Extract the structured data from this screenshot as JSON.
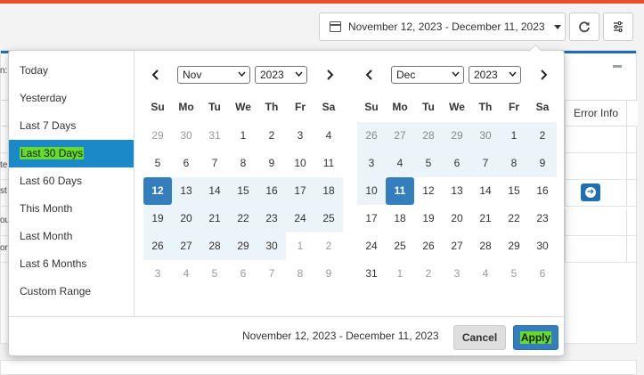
{
  "toolbar": {
    "date_range": "November 12, 2023 - December 11, 2023",
    "calendar_icon": "calendar-icon",
    "refresh_icon": "refresh-icon",
    "filter_icon": "sliders-icon"
  },
  "background": {
    "column_header": "Error Info",
    "left_fragments": [
      "n:",
      "te",
      "st",
      "ou",
      "or"
    ]
  },
  "ranges": [
    "Today",
    "Yesterday",
    "Last 7 Days",
    "Last 30 Days",
    "Last 60 Days",
    "This Month",
    "Last Month",
    "Last 6 Months",
    "Custom Range"
  ],
  "active_range": "Last 30 Days",
  "day_headers": [
    "Su",
    "Mo",
    "Tu",
    "We",
    "Th",
    "Fr",
    "Sa"
  ],
  "left_calendar": {
    "month": "Nov",
    "year": "2023",
    "prev_icon": "chevron-left-icon",
    "next_icon": "chevron-right-icon",
    "days": [
      [
        "29",
        "30",
        "31",
        "1",
        "2",
        "3",
        "4"
      ],
      [
        "5",
        "6",
        "7",
        "8",
        "9",
        "10",
        "11"
      ],
      [
        "12",
        "13",
        "14",
        "15",
        "16",
        "17",
        "18"
      ],
      [
        "19",
        "20",
        "21",
        "22",
        "23",
        "24",
        "25"
      ],
      [
        "26",
        "27",
        "28",
        "29",
        "30",
        "1",
        "2"
      ],
      [
        "3",
        "4",
        "5",
        "6",
        "7",
        "8",
        "9"
      ]
    ]
  },
  "right_calendar": {
    "month": "Dec",
    "year": "2023",
    "prev_icon": "chevron-left-icon",
    "next_icon": "chevron-right-icon",
    "days": [
      [
        "26",
        "27",
        "28",
        "29",
        "30",
        "1",
        "2"
      ],
      [
        "3",
        "4",
        "5",
        "6",
        "7",
        "8",
        "9"
      ],
      [
        "10",
        "11",
        "12",
        "13",
        "14",
        "15",
        "16"
      ],
      [
        "17",
        "18",
        "19",
        "20",
        "21",
        "22",
        "23"
      ],
      [
        "24",
        "25",
        "26",
        "27",
        "28",
        "29",
        "30"
      ],
      [
        "31",
        "1",
        "2",
        "3",
        "4",
        "5",
        "6"
      ]
    ]
  },
  "footer": {
    "selected_range": "November 12, 2023 - December 11, 2023",
    "cancel_label": "Cancel",
    "apply_label": "Apply"
  },
  "colors": {
    "accent": "#357ebd",
    "active_range_bg": "#1b88c8",
    "in_range_bg": "#ebf4f8",
    "highlight": "#63dc2a"
  }
}
